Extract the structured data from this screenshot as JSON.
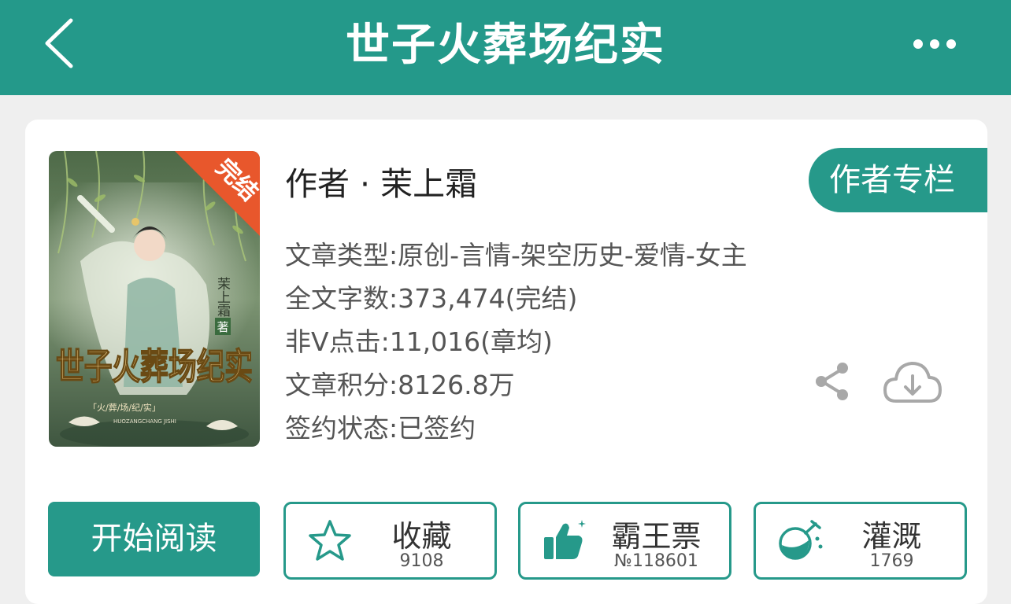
{
  "header": {
    "title": "世子火葬场纪实",
    "back_icon": "chevron-left-icon",
    "more_icon": "more-dots-icon",
    "color": "#24998a"
  },
  "book": {
    "cover": {
      "badge": "完结",
      "author_sign": "茉上霜",
      "author_sign_suffix": "著",
      "title_art": "世子火葬场纪实",
      "subtitle": "「火/葬/场/纪/实」",
      "pinyin": "HUOZANGCHANG JISHI"
    },
    "author_line": "作者 · 茉上霜",
    "author_column_button": "作者专栏",
    "info": [
      "文章类型:原创-言情-架空历史-爱情-女主",
      "全文字数:373,474(完结)",
      "非V点击:11,016(章均)",
      "文章积分:8126.8万",
      "签约状态:已签约"
    ]
  },
  "actions": {
    "read": "开始阅读",
    "collect": {
      "label": "收藏",
      "count": "9108",
      "icon": "star-icon"
    },
    "vote": {
      "label": "霸王票",
      "count": "№118601",
      "icon": "thumbs-up-icon"
    },
    "water": {
      "label": "灌溉",
      "count": "1769",
      "icon": "flask-icon"
    },
    "share_icon": "share-icon",
    "download_icon": "cloud-download-icon"
  },
  "colors": {
    "accent": "#26998a",
    "badge": "#e8572c"
  }
}
